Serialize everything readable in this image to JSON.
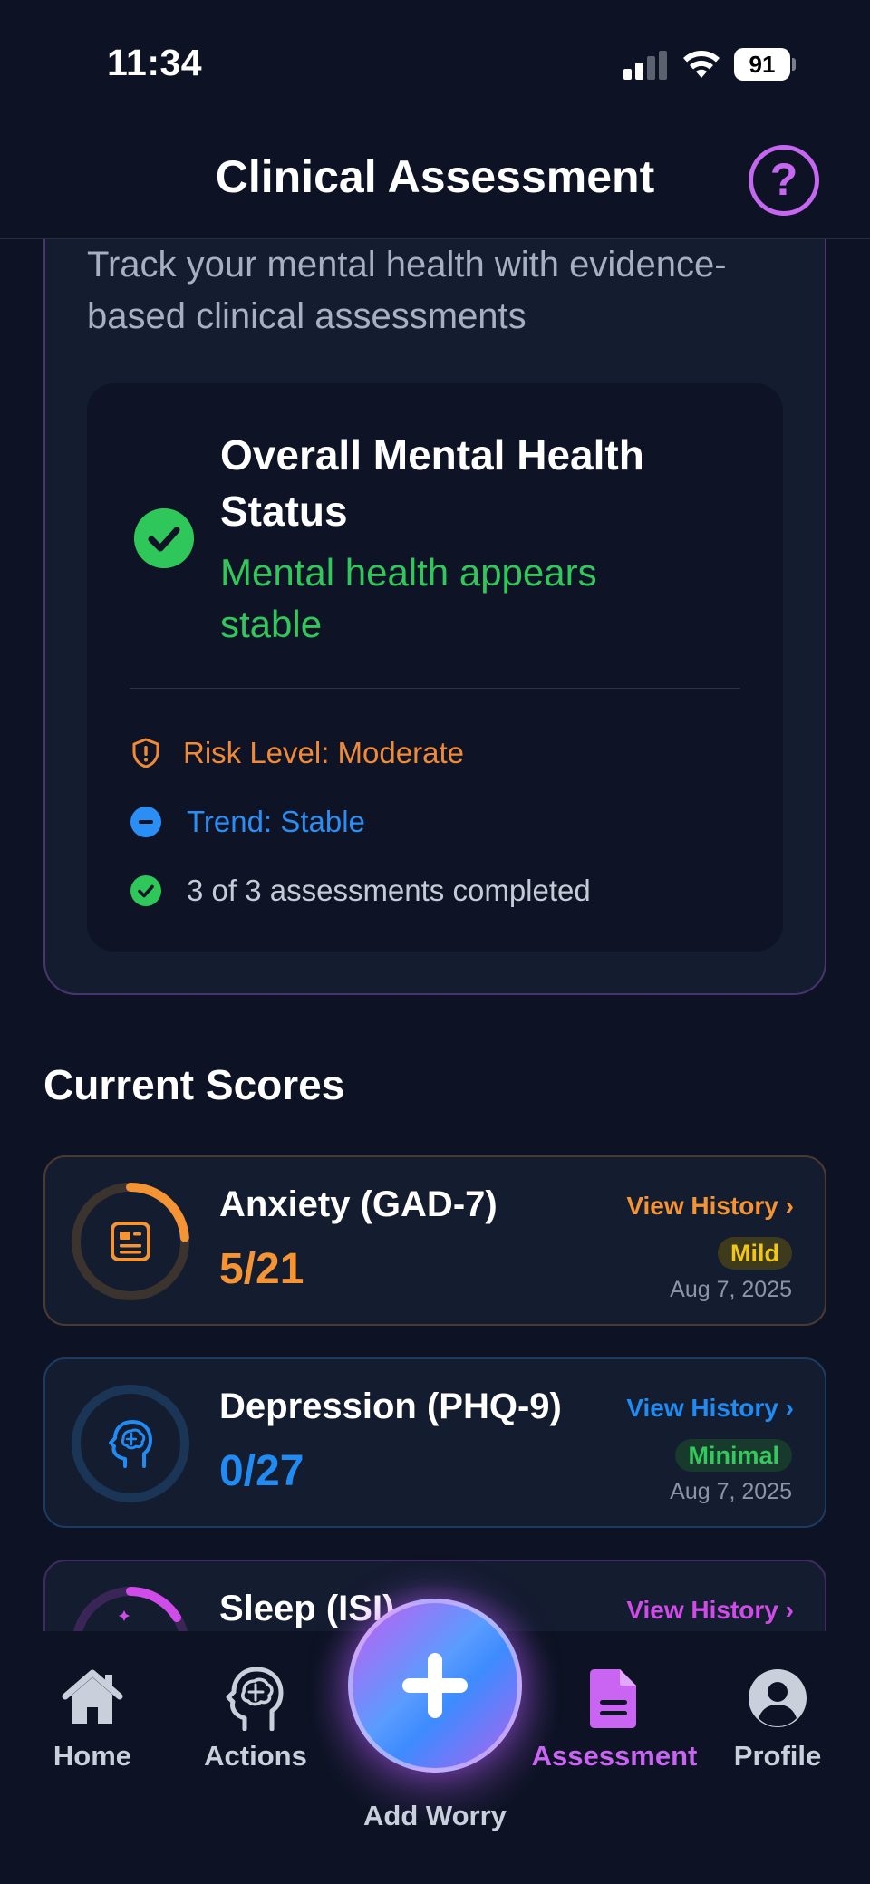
{
  "status_bar": {
    "time": "11:34",
    "battery": "91"
  },
  "header": {
    "title": "Clinical Assessment",
    "help_label": "?"
  },
  "intro": {
    "text": "Track your mental health with evidence-based clinical assessments"
  },
  "overall": {
    "heading": "Overall Mental Health Status",
    "summary": "Mental health appears stable",
    "rows": [
      {
        "icon": "shield-alert-icon",
        "text": "Risk Level: Moderate",
        "color": "#f08a36"
      },
      {
        "icon": "minus-circle-icon",
        "text": "Trend: Stable",
        "color": "#2a8ef5"
      },
      {
        "icon": "check-circle-icon",
        "text": "3 of 3 assessments completed",
        "color": "#c4cad6"
      }
    ]
  },
  "current_scores": {
    "title": "Current Scores",
    "items": [
      {
        "name": "Anxiety (GAD-7)",
        "score": "5/21",
        "score_value": 5,
        "score_max": 21,
        "severity": "Mild",
        "date": "Aug 7, 2025",
        "view_history": "View History",
        "accent": "#f49434",
        "border": "#4a3b2e",
        "ring_track": "#3b332e",
        "badge_bg": "#3e3a1c",
        "badge_fg": "#f0c51c",
        "icon": "clipboard-icon"
      },
      {
        "name": "Depression (PHQ-9)",
        "score": "0/27",
        "score_value": 0,
        "score_max": 27,
        "severity": "Minimal",
        "date": "Aug 7, 2025",
        "view_history": "View History",
        "accent": "#1f8bf3",
        "border": "#1c3b62",
        "ring_track": "#1b3557",
        "badge_bg": "#173a2c",
        "badge_fg": "#35c85c",
        "icon": "head-brain-icon"
      },
      {
        "name": "Sleep (ISI)",
        "view_history": "View History",
        "accent": "#d04ce8",
        "border": "#3f2b5e",
        "ring_track": "#3a2656",
        "icon": "sleep-icon"
      }
    ]
  },
  "tab_bar": {
    "tabs": [
      {
        "label": "Home",
        "icon": "home-icon"
      },
      {
        "label": "Actions",
        "icon": "brain-icon"
      },
      {
        "label": "Assessment",
        "icon": "document-icon",
        "active": true
      },
      {
        "label": "Profile",
        "icon": "profile-icon"
      }
    ],
    "fab_label": "Add Worry",
    "active_color": "#c965f2",
    "inactive_color": "#c9d0dc"
  }
}
